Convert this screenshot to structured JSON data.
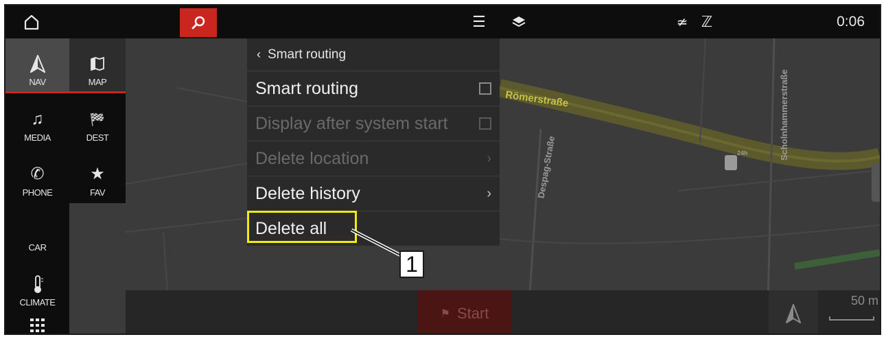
{
  "topbar": {
    "clock": "0:06",
    "icons": [
      "home-icon",
      "search-icon",
      "list-icon",
      "layers-icon",
      "no-signal-icon",
      "no-mobile-data-icon"
    ]
  },
  "map": {
    "streets": [
      "Römerstraße",
      "Despag-Straße",
      "Scholnhammerstraße"
    ],
    "poi": "24h"
  },
  "sidebar": {
    "main_items": [
      {
        "label": "NAV",
        "icon": "nav-arrow-icon"
      },
      {
        "label": "MEDIA",
        "icon": "music-note-icon"
      },
      {
        "label": "PHONE",
        "icon": "phone-icon"
      },
      {
        "label": "CAR",
        "icon": "car-icon"
      },
      {
        "label": "CLIMATE",
        "icon": "thermometer-icon"
      },
      {
        "label": "",
        "icon": "apps-grid-icon"
      }
    ],
    "sub_items": [
      {
        "label": "MAP",
        "icon": "map-icon"
      },
      {
        "label": "DEST",
        "icon": "checkered-flag-icon"
      },
      {
        "label": "FAV",
        "icon": "star-icon"
      }
    ]
  },
  "menu": {
    "header": "Smart routing",
    "rows": [
      {
        "label": "Smart routing",
        "control": "checkbox",
        "enabled": true
      },
      {
        "label": "Display after system start",
        "control": "checkbox",
        "enabled": false
      },
      {
        "label": "Delete location",
        "control": "chevron",
        "enabled": false
      },
      {
        "label": "Delete history",
        "control": "chevron",
        "enabled": true
      },
      {
        "label": "Delete all",
        "control": "none",
        "enabled": true
      }
    ]
  },
  "bottom": {
    "start_label": "Start",
    "scale_label": "50 m"
  },
  "callout": {
    "number": "1",
    "highlight_color": "#f3ea14"
  },
  "colors": {
    "accent": "#c8261e",
    "background": "#0d0d0d",
    "menu_bg": "#2a2a2a"
  }
}
